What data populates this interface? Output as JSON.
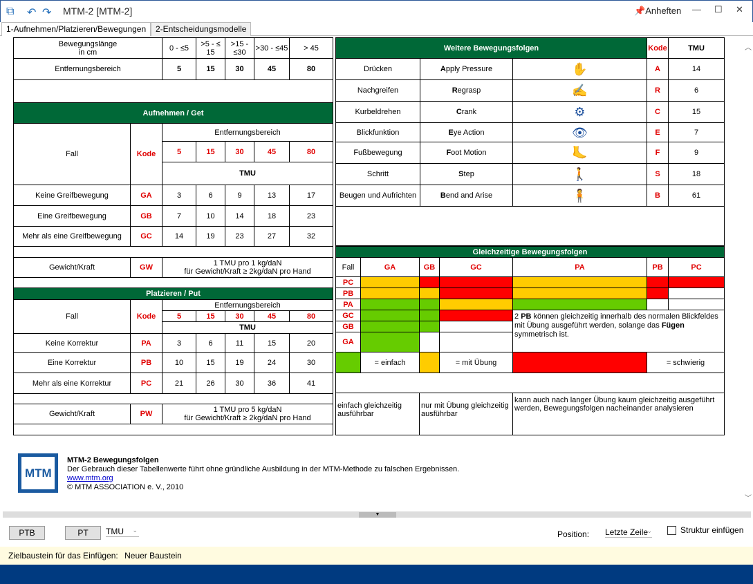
{
  "window": {
    "title": "MTM-2 [MTM-2]",
    "pin_label": "Anheften"
  },
  "tabs": [
    "1-Aufnehmen/Platzieren/Bewegungen",
    "2-Entscheidungsmodelle"
  ],
  "dist": {
    "header": "Bewegungslänge",
    "header2": "in cm",
    "ranges": [
      "0 - ≤5",
      ">5 - ≤ 15",
      ">15 - ≤30",
      ">30 - ≤45",
      "> 45"
    ],
    "label": "Entfernungsbereich",
    "codes": [
      "5",
      "15",
      "30",
      "45",
      "80"
    ]
  },
  "get": {
    "title": "Aufnehmen / Get",
    "fall": "Fall",
    "kode": "Kode",
    "range_label": "Entfernungsbereich",
    "tmu": "TMU",
    "codes": [
      "5",
      "15",
      "30",
      "45",
      "80"
    ],
    "rows": [
      {
        "label": "Keine Greifbewegung",
        "code": "GA",
        "vals": [
          "3",
          "6",
          "9",
          "13",
          "17"
        ]
      },
      {
        "label": "Eine Greifbewegung",
        "code": "GB",
        "vals": [
          "7",
          "10",
          "14",
          "18",
          "23"
        ]
      },
      {
        "label": "Mehr als eine Greifbewegung",
        "code": "GC",
        "vals": [
          "14",
          "19",
          "23",
          "27",
          "32"
        ]
      }
    ],
    "weight_label": "Gewicht/Kraft",
    "weight_code": "GW",
    "weight_text1": "1 TMU pro 1 kg/daN",
    "weight_text2": "für Gewicht/Kraft ≥ 2kg/daN pro Hand"
  },
  "put": {
    "title": "Platzieren / Put",
    "fall": "Fall",
    "kode": "Kode",
    "range_label": "Entfernungsbereich",
    "tmu": "TMU",
    "codes": [
      "5",
      "15",
      "30",
      "45",
      "80"
    ],
    "rows": [
      {
        "label": "Keine Korrektur",
        "code": "PA",
        "vals": [
          "3",
          "6",
          "11",
          "15",
          "20"
        ]
      },
      {
        "label": "Eine Korrektur",
        "code": "PB",
        "vals": [
          "10",
          "15",
          "19",
          "24",
          "30"
        ]
      },
      {
        "label": "Mehr als eine Korrektur",
        "code": "PC",
        "vals": [
          "21",
          "26",
          "30",
          "36",
          "41"
        ]
      }
    ],
    "weight_label": "Gewicht/Kraft",
    "weight_code": "PW",
    "weight_text1": "1 TMU pro 5 kg/daN",
    "weight_text2": "für Gewicht/Kraft ≥ 2kg/daN pro Hand"
  },
  "further": {
    "title": "Weitere Bewegungsfolgen",
    "kode": "Kode",
    "tmu": "TMU",
    "rows": [
      {
        "de": "Drücken",
        "en_first": "A",
        "en_rest": "pply Pressure",
        "icon": "press-icon",
        "code": "A",
        "tmu": "14"
      },
      {
        "de": "Nachgreifen",
        "en_first": "R",
        "en_rest": "egrasp",
        "icon": "regrasp-icon",
        "code": "R",
        "tmu": "6"
      },
      {
        "de": "Kurbeldrehen",
        "en_first": "C",
        "en_rest": "rank",
        "icon": "crank-icon",
        "code": "C",
        "tmu": "15"
      },
      {
        "de": "Blickfunktion",
        "en_first": "E",
        "en_rest": "ye Action",
        "icon": "eye-icon",
        "code": "E",
        "tmu": "7"
      },
      {
        "de": "Fußbewegung",
        "en_first": "F",
        "en_rest": "oot Motion",
        "icon": "foot-icon",
        "code": "F",
        "tmu": "9"
      },
      {
        "de": "Schritt",
        "en_first": "S",
        "en_rest": "tep",
        "icon": "step-icon",
        "code": "S",
        "tmu": "18"
      },
      {
        "de": "Beugen und Aufrichten",
        "en_first": "B",
        "en_rest": "end and Arise",
        "icon": "bend-icon",
        "code": "B",
        "tmu": "61"
      }
    ]
  },
  "simul": {
    "title": "Gleichzeitige Bewegungsfolgen",
    "fall": "Fall",
    "cols": [
      "GA",
      "GB",
      "GC",
      "PA",
      "PB",
      "PC"
    ],
    "rows": [
      "PC",
      "PB",
      "PA",
      "GC",
      "GB",
      "GA"
    ],
    "note_pre": "2 ",
    "note_bold1": "PB",
    "note_mid": " können gleichzeitig innerhalb des normalen Blickfeldes mit Übung ausgeführt werden, solange das ",
    "note_bold2": "Fügen",
    "note_post": " symmetrisch ist.",
    "legend_easy": "= einfach",
    "legend_practice": "= mit Übung",
    "legend_hard": "= schwierig",
    "desc_easy": "einfach gleichzeitig ausführbar",
    "desc_practice": "nur mit Übung gleichzeitig ausführbar",
    "desc_hard": "kann auch nach langer Übung kaum gleichzeitig ausgeführt werden, Bewegungsfolgen nacheinander analysieren",
    "colors": {
      "easy": "#66cc00",
      "practice": "#ffcc00",
      "hard": "#ff0000"
    }
  },
  "footer": {
    "logo": "MTM",
    "title": "MTM-2 Bewegungsfolgen",
    "text": "Der Gebrauch dieser Tabellenwerte führt ohne gründliche Ausbildung in der MTM-Methode zu falschen Ergebnissen.",
    "link": "www.mtm.org",
    "copy": "© MTM ASSOCIATION e. V., 2010"
  },
  "toolbar": {
    "ptb": "PTB",
    "pt": "PT",
    "unit": "TMU",
    "position_label": "Position:",
    "position_value": "Letzte Zeile",
    "struct_label": "Struktur einfügen"
  },
  "status": {
    "label": "Zielbaustein für das Einfügen:",
    "value": "Neuer Baustein"
  }
}
